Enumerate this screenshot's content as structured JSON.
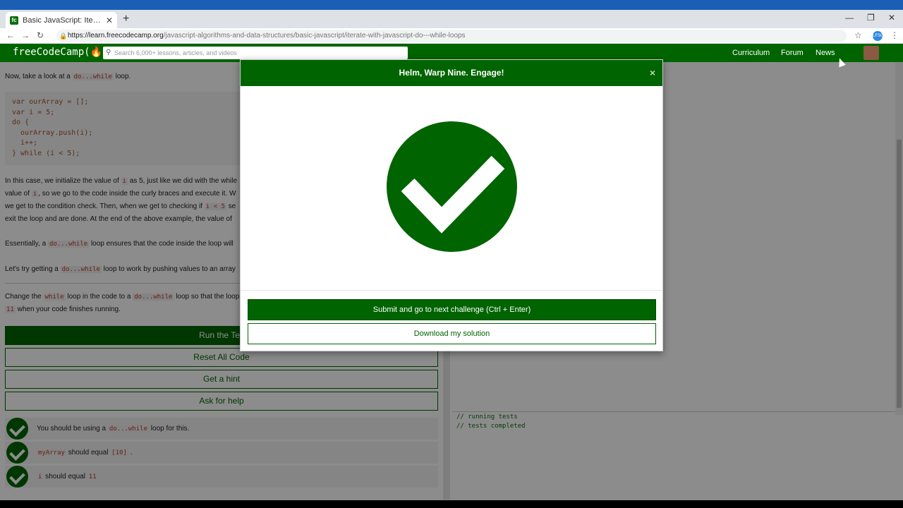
{
  "browser": {
    "tab_title": "Basic JavaScript: Iterate with Java",
    "tab_close": "✕",
    "new_tab": "+",
    "url_host": "https://learn.freecodecamp.org",
    "url_path": "/javascript-algorithms-and-data-structures/basic-javascript/iterate-with-javascript-do---while-loops",
    "ext_label": "LFSG"
  },
  "fcc": {
    "logo": "freeCodeCamp(🔥)",
    "search_placeholder": "Search 6,000+ lessons, articles, and videos",
    "nav": [
      "Curriculum",
      "Forum",
      "News"
    ]
  },
  "lesson": {
    "intro_prefix": "Now, take a look at a",
    "intro_code": "do...while",
    "intro_suffix": "loop.",
    "code": "var ourArray = [];\nvar i = 5;\ndo {\n  ourArray.push(i);\n  i++;\n} while (i < 5);",
    "p1_a": "In this case, we initialize the value of",
    "p1_code1": "i",
    "p1_b": "as 5, just like we did with the while",
    "p1_c": "value of",
    "p1_code2": "i",
    "p1_d": ", so we go to the code inside the curly braces and execute it. W",
    "p1_e": "we get to the condition check. Then, when we get to checking if",
    "p1_code3": "i < 5",
    "p1_f": "se",
    "p1_g": "exit the loop and are done. At the end of the above example, the value of",
    "p2_a": "Essentially, a",
    "p2_code": "do...while",
    "p2_b": "loop ensures that the code inside the loop will",
    "p3_a": "Let's try getting a",
    "p3_code": "do...while",
    "p3_b": "loop to work by pushing values to an array",
    "task_a": "Change the",
    "task_code1": "while",
    "task_b": "loop in the code to a",
    "task_code2": "do...while",
    "task_c": "loop so that the loop",
    "task_code3": "11",
    "task_d": "when your code finishes running.",
    "btn_run": "Run the Tes",
    "btn_reset": "Reset All Code",
    "btn_hint": "Get a hint",
    "btn_help": "Ask for help",
    "tests": [
      {
        "pre": "You should be using a",
        "code": "do...while",
        "post": "loop for this."
      },
      {
        "pre": "",
        "code": "myArray",
        "post": "should equal",
        "code2": "[10]",
        "post2": "."
      },
      {
        "pre": "",
        "code": "i",
        "post": "should equal",
        "code2": "11",
        "post2": ""
      }
    ]
  },
  "console": {
    "line1": "// running tests",
    "line2": "// tests completed"
  },
  "modal": {
    "title": "Helm, Warp Nine. Engage!",
    "close": "×",
    "submit": "Submit and go to next challenge (Ctrl + Enter)",
    "download": "Download my solution"
  },
  "colors": {
    "fcc_green": "#006400",
    "chrome_blue": "#1a5fb4"
  }
}
